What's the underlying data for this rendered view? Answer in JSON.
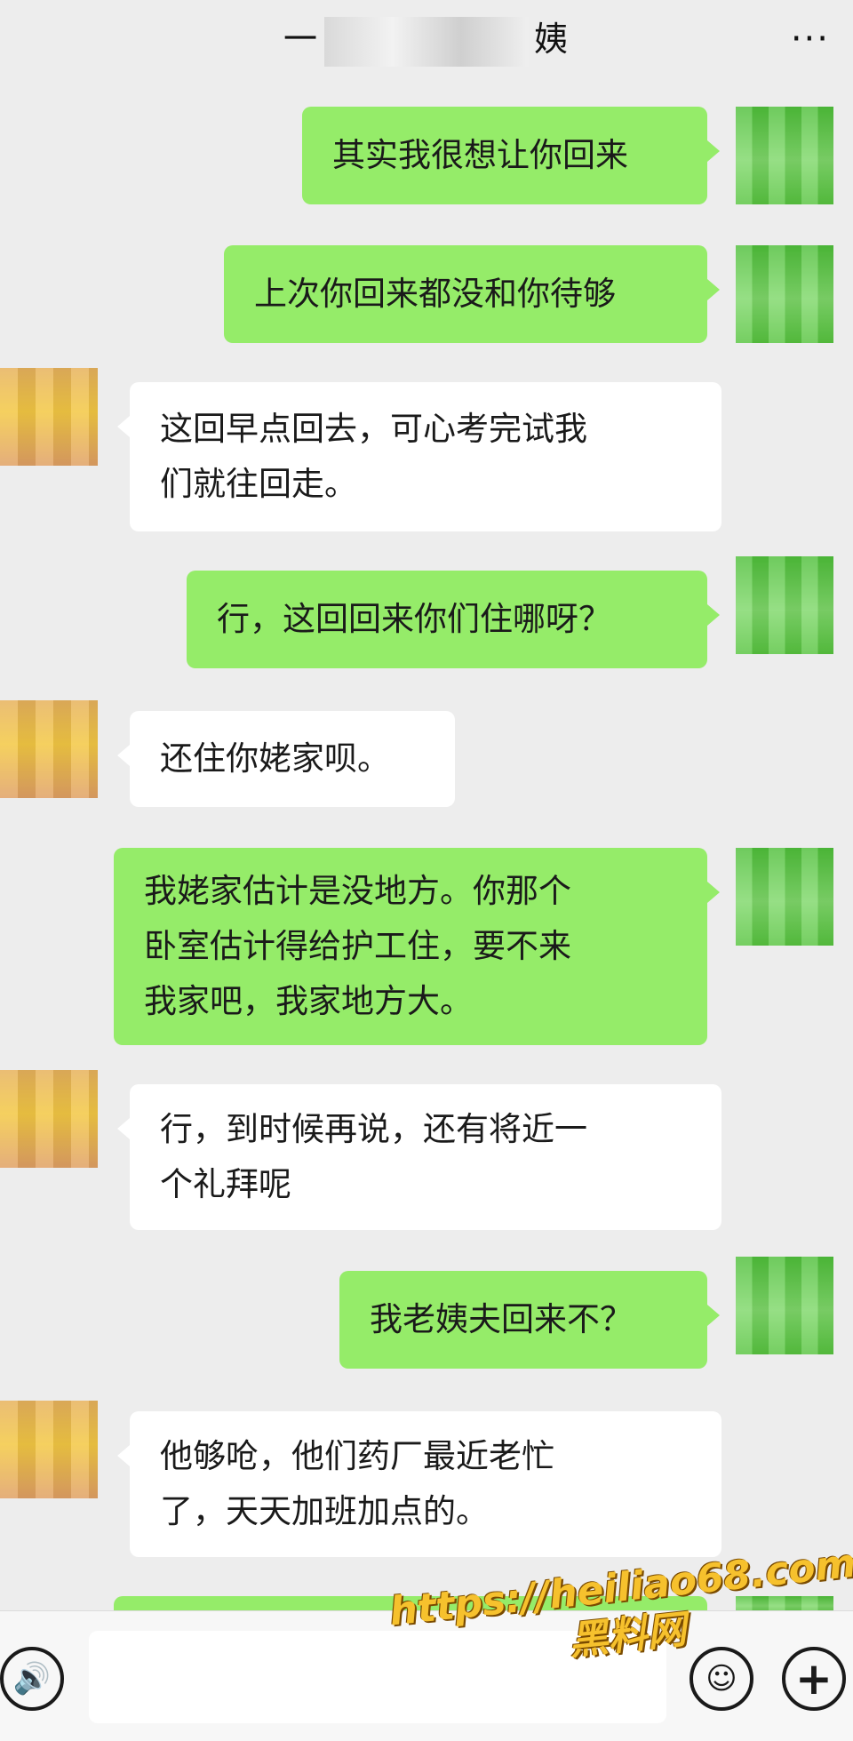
{
  "header": {
    "title_left": "一",
    "title_right": "姨",
    "more_label": "···"
  },
  "messages": [
    {
      "side": "me",
      "text": "其实我很想让你回来"
    },
    {
      "side": "me",
      "text": "上次你回来都没和你待够"
    },
    {
      "side": "other",
      "lines": [
        "这回早点回去，可心考完试我",
        "们就往回走。"
      ]
    },
    {
      "side": "me",
      "text": "行，这回回来你们住哪呀？"
    },
    {
      "side": "other",
      "text": "还住你姥家呗。"
    },
    {
      "side": "me",
      "lines": [
        "我姥家估计是没地方。你那个",
        "卧室估计得给护工住，要不来",
        "我家吧，我家地方大。"
      ]
    },
    {
      "side": "other",
      "lines": [
        "行，到时候再说，还有将近一",
        "个礼拜呢"
      ]
    },
    {
      "side": "me",
      "text": "我老姨夫回来不？"
    },
    {
      "side": "other",
      "lines": [
        "他够呛，他们药厂最近老忙",
        "了，天天加班加点的。"
      ]
    }
  ],
  "input_bar": {
    "voice_icon": "voice-icon",
    "emoji_icon": "emoji-icon",
    "plus_icon": "plus-icon",
    "voice_glyph": "🔊",
    "emoji_glyph": "☺",
    "plus_glyph": "+"
  },
  "watermark": {
    "line1": "https://heiliao68.com",
    "line2": "黑料网"
  }
}
